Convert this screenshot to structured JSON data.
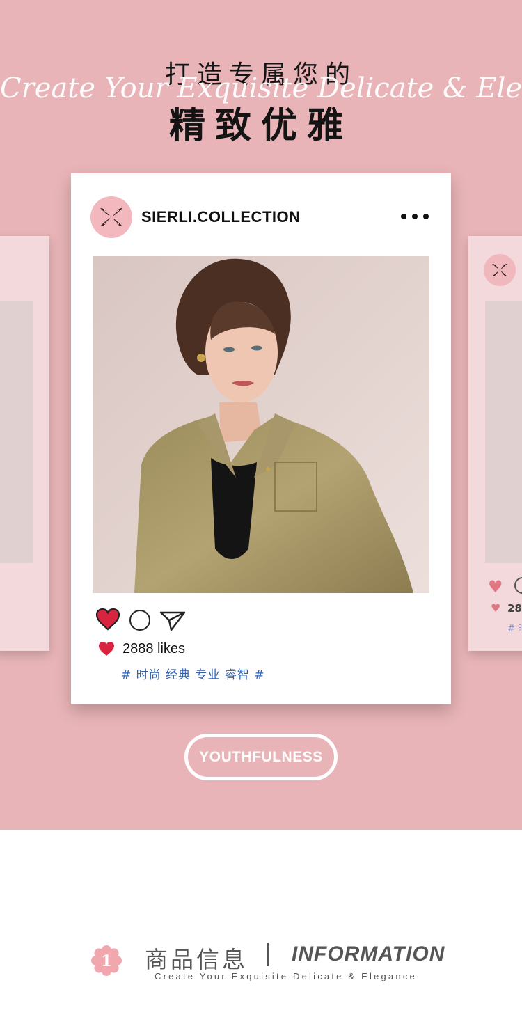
{
  "hero": {
    "headline_line1": "打造专属您的",
    "script_line": "Create Your Exquisite Delicate & Elegance",
    "headline_line2": "精致优雅",
    "background_color": "#e8b4b7"
  },
  "post": {
    "username": "SIERLI.COLLECTION",
    "avatar_icon": "sierli-logo-icon",
    "more_icon": "more-options-icon",
    "photo": "woman-in-olive-satin-shirt",
    "actions": {
      "like_icon": "heart-icon",
      "comment_icon": "comment-icon",
      "share_icon": "share-icon"
    },
    "likes_text": "2888 likes",
    "tags": "# 时尚 经典 专业 睿智 #",
    "like_color": "#d9243f",
    "tag_color": "#2f61b3"
  },
  "side_cards": {
    "right_count": "28",
    "right_tag": "# 时"
  },
  "badge_button": {
    "label": "YOUTHFULNESS"
  },
  "info_section": {
    "number": "1",
    "title_cn": "商品信息",
    "separator": "|",
    "title_en": "INFORMATION",
    "subtitle": "Create Your Exquisite Delicate & Elegance"
  }
}
